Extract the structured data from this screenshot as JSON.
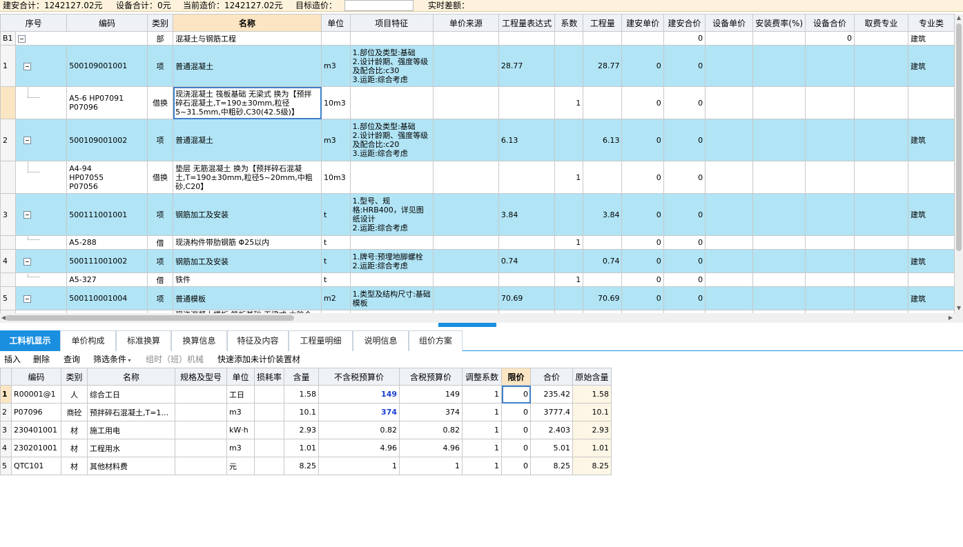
{
  "summary": {
    "jianan_total": "建安合计：1242127.02元",
    "device_total": "设备合计：0元",
    "current_cost": "当前造价：1242127.02元",
    "target_label": "目标造价：",
    "target_value": "",
    "realtime_diff": "实时差额："
  },
  "upper": {
    "headers": [
      "序号",
      "编码",
      "类别",
      "名称",
      "单位",
      "项目特征",
      "单价来源",
      "工程量表达式",
      "系数",
      "工程量",
      "建安单价",
      "建安合价",
      "设备单价",
      "安装费率(%)",
      "设备合价",
      "取费专业",
      "专业类"
    ],
    "section": {
      "rowno": "B1",
      "type": "部",
      "name": "混凝土与钢筋工程",
      "jianan_total": "0",
      "device_total": "0",
      "speciality": "建筑"
    },
    "items": [
      {
        "no": "1",
        "code": "500109001001",
        "type": "项",
        "name": "普通混凝土",
        "unit": "m3",
        "feature": "1.部位及类型:基础\n2.设计龄期、强度等级及配合比:c30\n3.运距:综合考虑",
        "expr": "28.77",
        "factor": "",
        "qty": "28.77",
        "price": "0",
        "total": "0",
        "speciality": "建筑",
        "sub": {
          "code": "A5-6 HP07091\nP07096",
          "type": "借换",
          "name": "现浇混凝土 筏板基础 无梁式  换为【预拌碎石混凝土,T=190±30mm,粒径5~31.5mm,中粗砂,C30(42.5级)】",
          "unit": "10m3",
          "factor": "1",
          "price": "0",
          "total": "0"
        }
      },
      {
        "no": "2",
        "code": "500109001002",
        "type": "项",
        "name": "普通混凝土",
        "unit": "m3",
        "feature": "1.部位及类型:基础\n2.设计龄期、强度等级及配合比:c20\n3.运距:综合考虑",
        "expr": "6.13",
        "factor": "",
        "qty": "6.13",
        "price": "0",
        "total": "0",
        "speciality": "建筑",
        "sub": {
          "code": "A4-94\nHP07055\nP07056",
          "type": "借换",
          "name": "垫层 无筋混凝土  换为【预拌碎石混凝土,T=190±30mm,粒径5~20mm,中粗砂,C20】",
          "unit": "10m3",
          "factor": "1",
          "price": "0",
          "total": "0"
        }
      },
      {
        "no": "3",
        "code": "500111001001",
        "type": "项",
        "name": "钢筋加工及安装",
        "unit": "t",
        "feature": "1.型号、规格:HRB400，详见图纸设计\n2.运距:综合考虑",
        "expr": "3.84",
        "factor": "",
        "qty": "3.84",
        "price": "0",
        "total": "0",
        "speciality": "建筑",
        "sub": {
          "code": "A5-288",
          "type": "借",
          "name": "现浇构件带肋钢筋 Φ25以内",
          "unit": "t",
          "factor": "1",
          "price": "0",
          "total": "0"
        }
      },
      {
        "no": "4",
        "code": "500111001002",
        "type": "项",
        "name": "钢筋加工及安装",
        "unit": "t",
        "feature": "1.牌号:预埋地脚螺栓\n2.运距:综合考虑",
        "expr": "0.74",
        "factor": "",
        "qty": "0.74",
        "price": "0",
        "total": "0",
        "speciality": "建筑",
        "sub": {
          "code": "A5-327",
          "type": "借",
          "name": "铁件",
          "unit": "t",
          "factor": "1",
          "price": "0",
          "total": "0"
        }
      },
      {
        "no": "5",
        "code": "500110001004",
        "type": "项",
        "name": "普通模板",
        "unit": "m2",
        "feature": "1.类型及结构尺寸:基础模板",
        "expr": "70.69",
        "factor": "",
        "qty": "70.69",
        "price": "0",
        "total": "0",
        "speciality": "建筑",
        "sub": {
          "code": "",
          "type": "",
          "name": "现浇混凝土模板 筏板基础 无梁式 木胶合",
          "unit": "",
          "factor": "",
          "price": "",
          "total": ""
        }
      }
    ]
  },
  "tabs": [
    "工料机显示",
    "单价构成",
    "标准换算",
    "换算信息",
    "特征及内容",
    "工程量明细",
    "说明信息",
    "组价方案"
  ],
  "toolbar": {
    "insert": "插入",
    "delete": "删除",
    "query": "查询",
    "filter": "筛选条件",
    "machine": "组时（班）机械",
    "quick_add": "快速添加未计价装置材"
  },
  "lower": {
    "headers": [
      "编码",
      "类别",
      "名称",
      "规格及型号",
      "单位",
      "损耗率",
      "含量",
      "不含税预算价",
      "含税预算价",
      "调整系数",
      "限价",
      "合价",
      "原始含量"
    ],
    "rows": [
      {
        "no": "1",
        "code": "R00001@1",
        "type": "人",
        "name": "综合工日",
        "spec": "",
        "unit": "工日",
        "loss": "",
        "qty": "1.58",
        "pre_tax": "149",
        "tax": "149",
        "adj": "1",
        "limit": "0",
        "total": "235.42",
        "orig": "1.58"
      },
      {
        "no": "2",
        "code": "P07096",
        "type": "商砼",
        "name": "预拌碎石混凝土,T=1…",
        "spec": "",
        "unit": "m3",
        "loss": "",
        "qty": "10.1",
        "pre_tax": "374",
        "tax": "374",
        "adj": "1",
        "limit": "0",
        "total": "3777.4",
        "orig": "10.1"
      },
      {
        "no": "3",
        "code": "230401001",
        "type": "材",
        "name": "施工用电",
        "spec": "",
        "unit": "kW·h",
        "loss": "",
        "qty": "2.93",
        "pre_tax": "0.82",
        "tax": "0.82",
        "adj": "1",
        "limit": "0",
        "total": "2.403",
        "orig": "2.93"
      },
      {
        "no": "4",
        "code": "230201001",
        "type": "材",
        "name": "工程用水",
        "spec": "",
        "unit": "m3",
        "loss": "",
        "qty": "1.01",
        "pre_tax": "4.96",
        "tax": "4.96",
        "adj": "1",
        "limit": "0",
        "total": "5.01",
        "orig": "1.01"
      },
      {
        "no": "5",
        "code": "QTC101",
        "type": "材",
        "name": "其他材料费",
        "spec": "",
        "unit": "元",
        "loss": "",
        "qty": "8.25",
        "pre_tax": "1",
        "tax": "1",
        "adj": "1",
        "limit": "0",
        "total": "8.25",
        "orig": "8.25"
      }
    ]
  },
  "colors": {
    "qd_row": "#b1e4f5",
    "tab_active": "#1a8fe0",
    "summary_bg": "#fdf3dc",
    "header_highlight": "#fbe5c2",
    "blue_value": "#1a3fd1"
  },
  "icons": {
    "collapse": "tree-collapse-icon",
    "dropdown": "filter-dropdown-icon"
  }
}
